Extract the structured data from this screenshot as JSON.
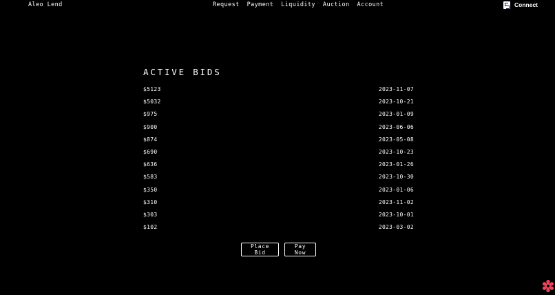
{
  "header": {
    "brand": "Aleo Lend",
    "nav": [
      "Request",
      "Payment",
      "Liquidity",
      "Auction",
      "Account"
    ],
    "connect_label": "Connect",
    "connect_icon": "wallet-icon"
  },
  "main": {
    "title": "ACTIVE BIDS",
    "bids": [
      {
        "amount": "$5123",
        "date": "2023-11-07"
      },
      {
        "amount": "$5032",
        "date": "2023-10-21"
      },
      {
        "amount": "$975",
        "date": "2023-01-09"
      },
      {
        "amount": "$900",
        "date": "2023-06-06"
      },
      {
        "amount": "$874",
        "date": "2023-05-08"
      },
      {
        "amount": "$690",
        "date": "2023-10-23"
      },
      {
        "amount": "$636",
        "date": "2023-01-26"
      },
      {
        "amount": "$583",
        "date": "2023-10-30"
      },
      {
        "amount": "$350",
        "date": "2023-01-06"
      },
      {
        "amount": "$310",
        "date": "2023-11-02"
      },
      {
        "amount": "$303",
        "date": "2023-10-01"
      },
      {
        "amount": "$102",
        "date": "2023-03-02"
      }
    ],
    "place_bid_label": "Place Bid",
    "pay_now_label": "Pay Now"
  },
  "corner_icon": "gear-flower-icon",
  "colors": {
    "background": "#000000",
    "text": "#ffffff",
    "corner_icon": "#e8455c"
  }
}
